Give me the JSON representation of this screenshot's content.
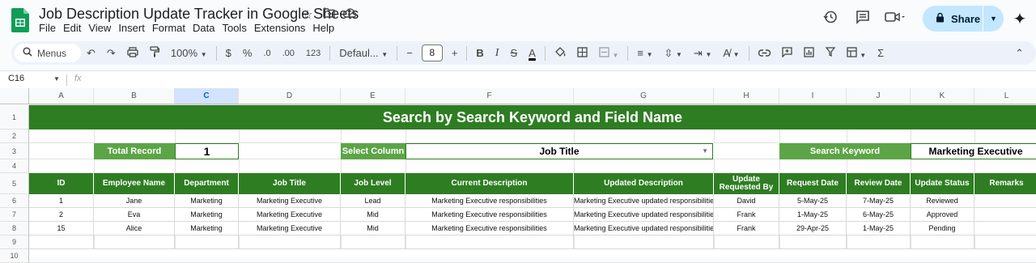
{
  "app": {
    "doc_title": "Job Description Update Tracker in Google Sheets",
    "menus": [
      "File",
      "Edit",
      "View",
      "Insert",
      "Format",
      "Data",
      "Tools",
      "Extensions",
      "Help"
    ],
    "share_label": "Share"
  },
  "toolbar": {
    "menus_label": "Menus",
    "zoom": "100%",
    "currency": "$",
    "percent": "%",
    "dec_decrease": ".0",
    "dec_increase": ".00",
    "number_format": "123",
    "font": "Defaul...",
    "font_size": "8",
    "functions": "Σ"
  },
  "formula_bar": {
    "cell_ref": "C16",
    "fx": "fx"
  },
  "columns": [
    "A",
    "B",
    "C",
    "D",
    "E",
    "F",
    "G",
    "H",
    "I",
    "J",
    "K",
    "L"
  ],
  "selected_column": "C",
  "rows": [
    "1",
    "2",
    "3",
    "4",
    "5",
    "6",
    "7",
    "8",
    "9",
    "10"
  ],
  "sheet": {
    "banner": "Search by Search Keyword and Field Name",
    "total_record_label": "Total Record",
    "total_record_value": "1",
    "select_column_label": "Select Column",
    "select_column_value": "Job Title",
    "search_keyword_label": "Search Keyword",
    "search_keyword_value": "Marketing Executive",
    "headers": [
      "ID",
      "Employee Name",
      "Department",
      "Job Title",
      "Job Level",
      "Current Description",
      "Updated Description",
      "Update Requested By",
      "Request Date",
      "Review Date",
      "Update Status",
      "Remarks"
    ],
    "records": [
      [
        "1",
        "Jane",
        "Marketing",
        "Marketing Executive",
        "Lead",
        "Marketing Executive responsibilities",
        "Marketing Executive updated responsibilities",
        "David",
        "5-May-25",
        "7-May-25",
        "Reviewed",
        ""
      ],
      [
        "2",
        "Eva",
        "Marketing",
        "Marketing Executive",
        "Mid",
        "Marketing Executive responsibilities",
        "Marketing Executive updated responsibilities",
        "Frank",
        "1-May-25",
        "6-May-25",
        "Approved",
        ""
      ],
      [
        "15",
        "Alice",
        "Marketing",
        "Marketing Executive",
        "Mid",
        "Marketing Executive responsibilities",
        "Marketing Executive updated responsibilities",
        "Frank",
        "29-Apr-25",
        "1-May-25",
        "Pending",
        ""
      ]
    ]
  },
  "colors": {
    "banner_green": "#2e7d22",
    "label_green": "#5ca546",
    "share_blue": "#c2e7ff"
  }
}
